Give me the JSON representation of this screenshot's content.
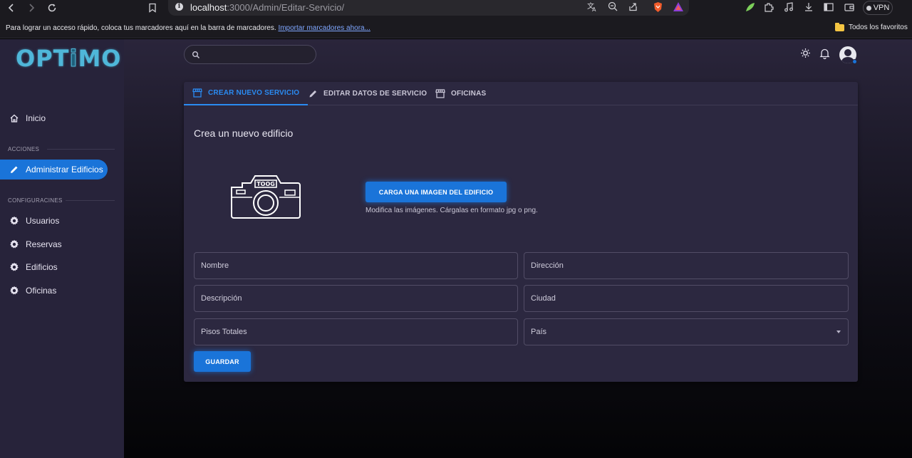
{
  "browser": {
    "url_host": "localhost",
    "url_path": ":3000/Admin/Editar-Servicio/",
    "vpn_label": "VPN",
    "bookmarks_message": "Para lograr un acceso rápido, coloca tus marcadores aquí en la barra de marcadores.",
    "bookmarks_import_link": "Importar marcadores ahora...",
    "favorites_folder": "Todos los favoritos"
  },
  "app": {
    "logo": "OPTIMO",
    "search_placeholder": ""
  },
  "sidebar": {
    "home_label": "Inicio",
    "section_actions": "ACCIONES",
    "actions": [
      {
        "label": "Administrar Edificios",
        "icon": "pencil-icon",
        "active": true
      }
    ],
    "section_config": "CONFIGURACINES",
    "config_items": [
      {
        "label": "Usuarios",
        "icon": "gear-icon"
      },
      {
        "label": "Reservas",
        "icon": "gear-icon"
      },
      {
        "label": "Edificios",
        "icon": "gear-icon"
      },
      {
        "label": "Oficinas",
        "icon": "gear-icon"
      }
    ]
  },
  "tabs": [
    {
      "label": "CREAR NUEVO SERVICIO",
      "icon": "storefront-icon",
      "active": true
    },
    {
      "label": "EDITAR DATOS DE SERVICIO",
      "icon": "pencil-icon",
      "active": false
    },
    {
      "label": "OFICINAS",
      "icon": "storefront-icon",
      "active": false
    }
  ],
  "form": {
    "title": "Crea un nuevo edificio",
    "camera_text": "TOOG",
    "upload_button": "CARGA UNA IMAGEN DEL EDIFICIO",
    "upload_hint": "Modifica las imágenes. Cárgalas en formato jpg o png.",
    "fields": {
      "nombre": "Nombre",
      "direccion": "Dirección",
      "descripcion": "Descripción",
      "ciudad": "Ciudad",
      "pisos": "Pisos Totales",
      "pais": "País"
    },
    "save_button": "GUARDAR"
  },
  "colors": {
    "accent": "#1a74d9",
    "sidebar_bg": "#27233a",
    "card_bg": "#2c2840"
  }
}
